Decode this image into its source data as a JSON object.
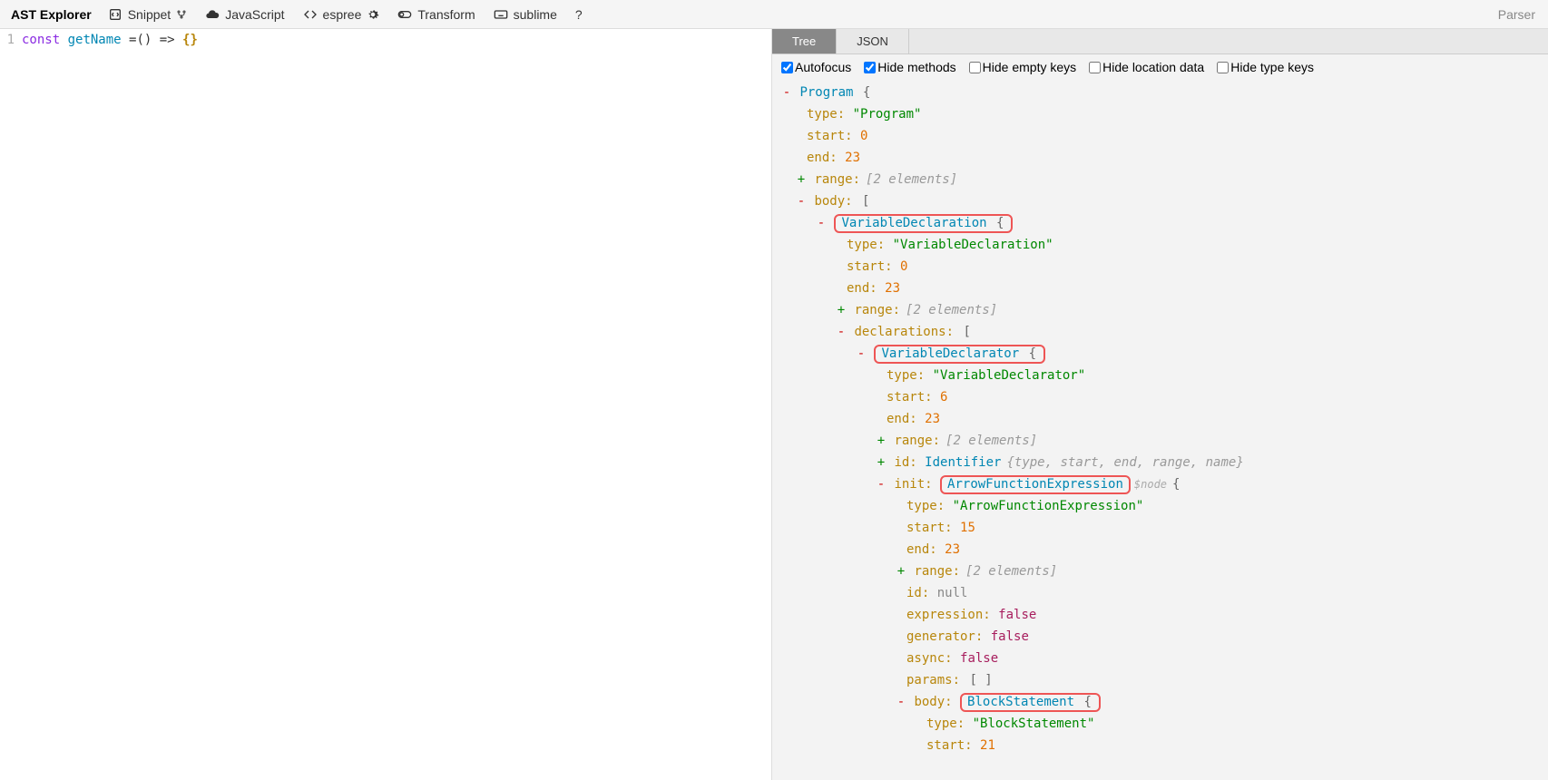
{
  "toolbar": {
    "brand": "AST Explorer",
    "snippet": "Snippet",
    "language": "JavaScript",
    "parser": "espree",
    "transform": "Transform",
    "keymap": "sublime",
    "help": "?",
    "right": "Parser"
  },
  "editor": {
    "line_no": "1",
    "kw": "const",
    "fn": "getName",
    "op": " =() => ",
    "br": "{}"
  },
  "tabs": {
    "tree": "Tree",
    "json": "JSON"
  },
  "checks": {
    "autofocus": "Autofocus",
    "hide_methods": "Hide methods",
    "hide_empty": "Hide empty keys",
    "hide_loc": "Hide location data",
    "hide_type": "Hide type keys"
  },
  "hints": {
    "two_elem": "[2 elements]",
    "id_props": "{type, start, end, range, name}",
    "node": "$node"
  },
  "ast": {
    "program_node": "Program",
    "program_type_k": "type:",
    "program_type_v": "\"Program\"",
    "program_start_k": "start:",
    "program_start_v": "0",
    "program_end_k": "end:",
    "program_end_v": "23",
    "program_range_k": "range:",
    "program_body_k": "body:",
    "vd_node": "VariableDeclaration",
    "vd_type_k": "type:",
    "vd_type_v": "\"VariableDeclaration\"",
    "vd_start_k": "start:",
    "vd_start_v": "0",
    "vd_end_k": "end:",
    "vd_end_v": "23",
    "vd_range_k": "range:",
    "vd_decl_k": "declarations:",
    "vr_node": "VariableDeclarator",
    "vr_type_k": "type:",
    "vr_type_v": "\"VariableDeclarator\"",
    "vr_start_k": "start:",
    "vr_start_v": "6",
    "vr_end_k": "end:",
    "vr_end_v": "23",
    "vr_range_k": "range:",
    "vr_id_k": "id:",
    "vr_id_node": "Identifier",
    "vr_init_k": "init:",
    "afe_node": "ArrowFunctionExpression",
    "afe_type_k": "type:",
    "afe_type_v": "\"ArrowFunctionExpression\"",
    "afe_start_k": "start:",
    "afe_start_v": "15",
    "afe_end_k": "end:",
    "afe_end_v": "23",
    "afe_range_k": "range:",
    "afe_id_k": "id:",
    "afe_id_v": "null",
    "afe_expr_k": "expression:",
    "afe_expr_v": "false",
    "afe_gen_k": "generator:",
    "afe_gen_v": "false",
    "afe_async_k": "async:",
    "afe_async_v": "false",
    "afe_params_k": "params:",
    "afe_params_v": "[ ]",
    "afe_body_k": "body:",
    "bs_node": "BlockStatement",
    "bs_type_k": "type:",
    "bs_type_v": "\"BlockStatement\"",
    "bs_start_k": "start:",
    "bs_start_v": "21"
  }
}
